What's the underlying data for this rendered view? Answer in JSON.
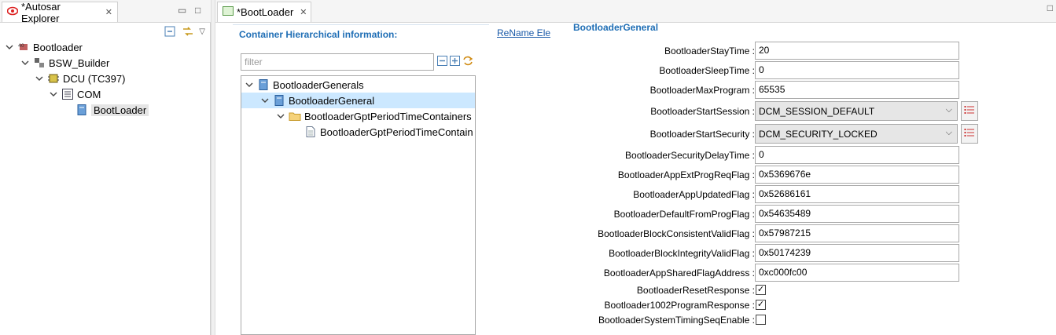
{
  "explorer": {
    "tab_title": "*Autosar Explorer",
    "tree": [
      {
        "label": "Bootloader"
      },
      {
        "label": "BSW_Builder"
      },
      {
        "label": "DCU (TC397)"
      },
      {
        "label": "COM"
      },
      {
        "label": "BootLoader"
      }
    ]
  },
  "editor": {
    "tab_title": "*BootLoader",
    "hierarchy_title": "Container Hierarchical information:",
    "rename_link": "ReName Ele",
    "filter_placeholder": "filter",
    "containers": [
      {
        "label": "BootloaderGenerals"
      },
      {
        "label": "BootloaderGeneral"
      },
      {
        "label": "BootloaderGptPeriodTimeContainers"
      },
      {
        "label": "BootloaderGptPeriodTimeContain"
      }
    ],
    "form_title": "BootloaderGeneral",
    "fields": [
      {
        "label": "BootloaderStayTime :",
        "value": "20"
      },
      {
        "label": "BootloaderSleepTime :",
        "value": "0"
      },
      {
        "label": "BootloaderMaxProgram :",
        "value": "65535"
      },
      {
        "label": "BootloaderStartSession :",
        "value": "DCM_SESSION_DEFAULT"
      },
      {
        "label": "BootloaderStartSecurity :",
        "value": "DCM_SECURITY_LOCKED"
      },
      {
        "label": "BootloaderSecurityDelayTime :",
        "value": "0"
      },
      {
        "label": "BootloaderAppExtProgReqFlag :",
        "value": "0x5369676e"
      },
      {
        "label": "BootloaderAppUpdatedFlag :",
        "value": "0x52686161"
      },
      {
        "label": "BootloaderDefaultFromProgFlag :",
        "value": "0x54635489"
      },
      {
        "label": "BootloaderBlockConsistentValidFlag :",
        "value": "0x57987215"
      },
      {
        "label": "BootloaderBlockIntegrityValidFlag :",
        "value": "0x50174239"
      },
      {
        "label": "BootloaderAppSharedFlagAddress :",
        "value": "0xc000fc00"
      }
    ],
    "checkboxes": [
      {
        "label": "BootloaderResetResponse :",
        "checked": true
      },
      {
        "label": "Bootloader1002ProgramResponse :",
        "checked": true
      },
      {
        "label": "BootloaderSystemTimingSeqEnable :",
        "checked": false
      }
    ]
  },
  "colors": {
    "accent_blue": "#1f6eb5",
    "selection": "#cce8ff",
    "link": "#1a5aa8"
  }
}
